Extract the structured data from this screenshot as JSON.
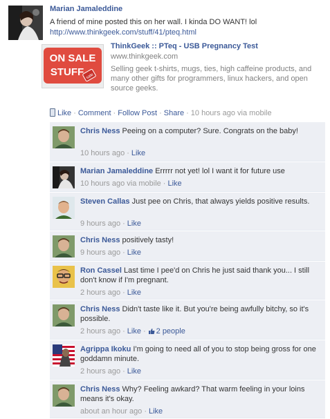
{
  "post": {
    "author": "Marian Jamaleddine",
    "message": "A friend of mine posted this on her wall. I kinda DO WANT! lol",
    "url": "http://www.thinkgeek.com/stuff/41/pteq.html",
    "attachment": {
      "title": "ThinkGeek :: PTeq - USB Pregnancy Test",
      "domain": "www.thinkgeek.com",
      "description": "Selling geek t-shirts, mugs, ties, high caffeine products, and many other gifts for programmers, linux hackers, and open source geeks.",
      "thumb_line1": "ON SALE",
      "thumb_line2": "STUFF",
      "thumb_tag": "sale"
    },
    "actions": {
      "like": "Like",
      "comment": "Comment",
      "follow": "Follow Post",
      "share": "Share",
      "timestamp": "10 hours ago via mobile"
    }
  },
  "comments": [
    {
      "author": "Chris Ness",
      "text": "Peeing on a computer? Sure. Congrats on the baby!",
      "time": "10 hours ago",
      "like": "Like",
      "avatar": "chris"
    },
    {
      "author": "Marian Jamaleddine",
      "text": "Errrrr not yet! lol I want it for future use",
      "time": "10 hours ago via mobile",
      "like": "Like",
      "avatar": "marian"
    },
    {
      "author": "Steven Callas",
      "text": "Just pee on Chris, that always yields positive results.",
      "time": "9 hours ago",
      "like": "Like",
      "avatar": "steven"
    },
    {
      "author": "Chris Ness",
      "text": "positively tasty!",
      "time": "9 hours ago",
      "like": "Like",
      "avatar": "chris"
    },
    {
      "author": "Ron Cassel",
      "text": "Last time I pee'd on Chris he just said thank you... I still don't know if I'm pregnant.",
      "time": "2 hours ago",
      "like": "Like",
      "avatar": "ron"
    },
    {
      "author": "Chris Ness",
      "text": "Didn't taste like it. But you're being awfully bitchy, so it's possible.",
      "time": "2 hours ago",
      "like": "Like",
      "likes_count": "2 people",
      "avatar": "chris"
    },
    {
      "author": "Agrippa Ikoku",
      "text": "I'm going to need all of you to stop being gross for one goddamn minute.",
      "time": "2 hours ago",
      "like": "Like",
      "avatar": "agrippa"
    },
    {
      "author": "Chris Ness",
      "text": "Why? Feeling awkard? That warm feeling in your loins means it's okay.",
      "time": "about an hour ago",
      "like": "Like",
      "avatar": "chris"
    }
  ],
  "colors": {
    "link": "#3b5998",
    "comment_bg": "#edeff4",
    "muted": "#999999"
  }
}
